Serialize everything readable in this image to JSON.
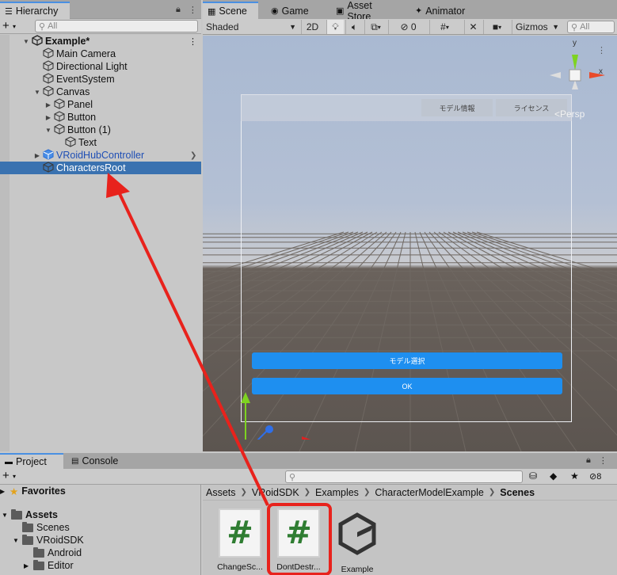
{
  "hierarchy": {
    "tab_label": "Hierarchy",
    "search_placeholder": "All",
    "items": [
      {
        "label": "Example*",
        "depth": 0,
        "fold": "open",
        "kind": "scene"
      },
      {
        "label": "Main Camera",
        "depth": 1,
        "fold": "none",
        "kind": "object"
      },
      {
        "label": "Directional Light",
        "depth": 1,
        "fold": "none",
        "kind": "object"
      },
      {
        "label": "EventSystem",
        "depth": 1,
        "fold": "none",
        "kind": "object"
      },
      {
        "label": "Canvas",
        "depth": 1,
        "fold": "open",
        "kind": "object"
      },
      {
        "label": "Panel",
        "depth": 2,
        "fold": "closed",
        "kind": "object"
      },
      {
        "label": "Button",
        "depth": 2,
        "fold": "closed",
        "kind": "object"
      },
      {
        "label": "Button (1)",
        "depth": 2,
        "fold": "open",
        "kind": "object"
      },
      {
        "label": "Text",
        "depth": 3,
        "fold": "none",
        "kind": "object"
      },
      {
        "label": "VRoidHubController",
        "depth": 1,
        "fold": "closed",
        "kind": "prefab"
      },
      {
        "label": "CharactersRoot",
        "depth": 1,
        "fold": "none",
        "kind": "object",
        "selected": true
      }
    ]
  },
  "scene": {
    "tabs": [
      {
        "label": "Scene",
        "icon": "grid-icon",
        "active": true
      },
      {
        "label": "Game",
        "icon": "gamepad-icon",
        "active": false
      },
      {
        "label": "Asset Store",
        "icon": "store-icon",
        "active": false
      },
      {
        "label": "Animator",
        "icon": "animator-icon",
        "active": false
      }
    ],
    "shading_mode": "Shaded",
    "mode_2d": "2D",
    "hidden_count": "0",
    "gizmos_label": "Gizmos",
    "search_placeholder": "All",
    "persp_label": "<Persp",
    "axis_y": "y",
    "axis_x": "x",
    "ui_tabs": [
      "モデル情報",
      "ライセンス"
    ],
    "ui_buttons": [
      "モデル選択",
      "OK"
    ]
  },
  "project": {
    "tabs": [
      {
        "label": "Project",
        "active": true
      },
      {
        "label": "Console",
        "active": false
      }
    ],
    "hidden_count": "8",
    "favorites_label": "Favorites",
    "tree": [
      {
        "label": "Assets",
        "depth": 0,
        "fold": "open",
        "bold": true
      },
      {
        "label": "Scenes",
        "depth": 1,
        "fold": "none"
      },
      {
        "label": "VRoidSDK",
        "depth": 1,
        "fold": "open"
      },
      {
        "label": "Android",
        "depth": 2,
        "fold": "none"
      },
      {
        "label": "Editor",
        "depth": 2,
        "fold": "closed"
      }
    ],
    "breadcrumb": [
      "Assets",
      "VRoidSDK",
      "Examples",
      "CharacterModelExample",
      "Scenes"
    ],
    "assets": [
      {
        "label": "ChangeSc...",
        "type": "script"
      },
      {
        "label": "DontDestr...",
        "type": "script",
        "highlighted": true
      },
      {
        "label": "Example",
        "type": "unity-scene"
      }
    ]
  },
  "colors": {
    "selection": "#3a72b0",
    "ui_button": "#1e8ff0",
    "annotation": "#e8221c",
    "prefab_text": "#1f4fb5"
  }
}
